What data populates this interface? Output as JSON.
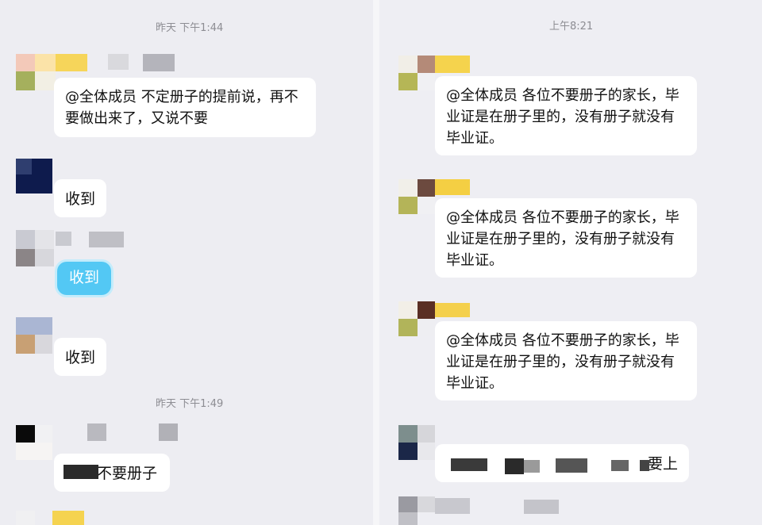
{
  "left_panel": {
    "timestamp_1": "昨天 下午1:44",
    "timestamp_2": "昨天 下午1:49",
    "messages": [
      {
        "text": "@全体成员 不定册子的提前说，再不要做出来了，又说不要"
      },
      {
        "text": "收到"
      },
      {
        "text": "收到"
      },
      {
        "text": "收到"
      },
      {
        "text": "不要册子"
      }
    ]
  },
  "right_panel": {
    "timestamp_1": "上午8:21",
    "messages": [
      {
        "text": "@全体成员 各位不要册子的家长，毕业证是在册子里的，没有册子就没有毕业证。"
      },
      {
        "text": "@全体成员 各位不要册子的家长，毕业证是在册子里的，没有册子就没有毕业证。"
      },
      {
        "text": "@全体成员 各位不要册子的家长，毕业证是在册子里的，没有册子就没有毕业证。"
      },
      {
        "text": "要上"
      }
    ]
  },
  "colors": {
    "background": "#ededf2",
    "bubble": "#ffffff",
    "self_bubble": "#53c8f4",
    "timestamp": "#8d8d93"
  }
}
